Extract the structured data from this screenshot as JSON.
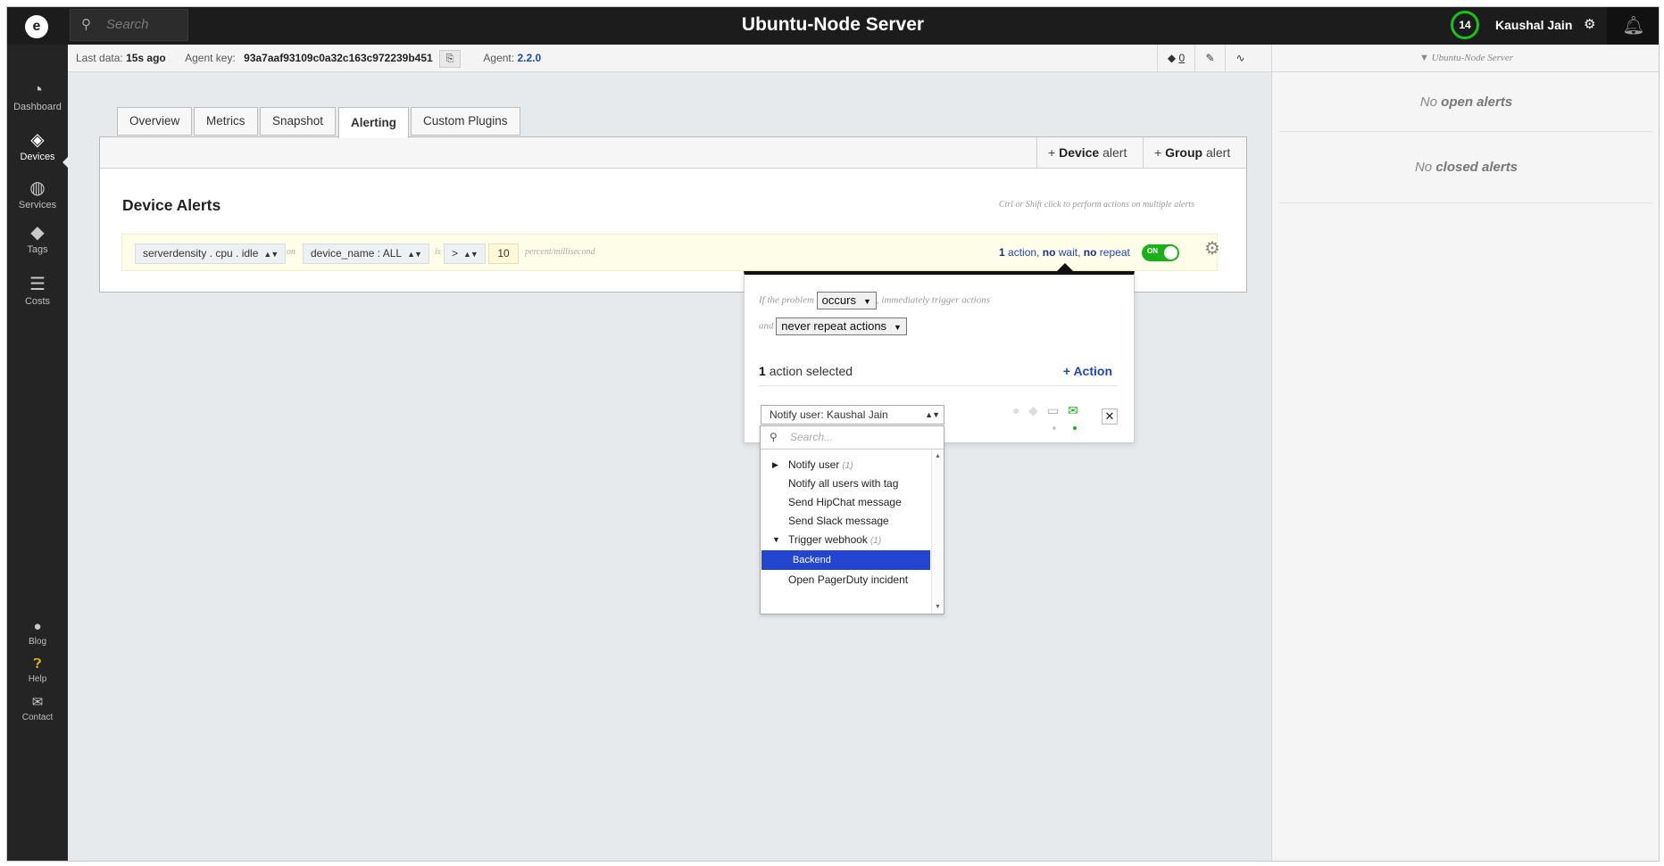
{
  "app": {
    "logo": "e",
    "search_placeholder": "Search",
    "title": "Ubuntu-Node Server",
    "notification_count": "14",
    "user_name": "Kaushal Jain"
  },
  "nav": {
    "dashboard": "Dashboard",
    "devices": "Devices",
    "services": "Services",
    "tags": "Tags",
    "costs": "Costs",
    "blog": "Blog",
    "help": "Help",
    "contact": "Contact"
  },
  "infobar": {
    "last_data_label": "Last data:",
    "last_data_value": "15s ago",
    "agent_key_label": "Agent key:",
    "agent_key_value": "93a7aaf93109c0a32c163c972239b451",
    "agent_label": "Agent:",
    "agent_version": "2.2.0",
    "tag_count": "0"
  },
  "right_panel": {
    "filter_label": "Ubuntu-Node Server",
    "open_alerts_prefix": "No",
    "open_alerts_suffix": "open alerts",
    "closed_alerts_prefix": "No",
    "closed_alerts_suffix": "closed alerts"
  },
  "tabs": [
    "Overview",
    "Metrics",
    "Snapshot",
    "Alerting",
    "Custom Plugins"
  ],
  "active_tab": "Alerting",
  "panel": {
    "device_alert_bold": "Device",
    "device_alert_rest": "alert",
    "group_alert_bold": "Group",
    "group_alert_rest": "alert",
    "title": "Device Alerts",
    "hint": "Ctrl or Shift click to perform actions on multiple alerts"
  },
  "alert": {
    "metric": "serverdensity . cpu . idle",
    "on_word": "on",
    "scope": "device_name : ALL",
    "is_word": "is",
    "operator": ">",
    "value": "10",
    "unit": "percent/millisecond",
    "summary_count": "1",
    "summary_action": "action,",
    "summary_no1": "no",
    "summary_wait": "wait,",
    "summary_no2": "no",
    "summary_repeat": "repeat",
    "toggle_state": "ON",
    "toggle_color": "#1bb01b"
  },
  "popover": {
    "line1_prefix": "If the problem",
    "trigger_option": "occurs",
    "line1_suffix": ", immediately trigger actions",
    "line2_prefix": "and",
    "repeat_option": "never repeat actions",
    "selected_count": "1",
    "selected_label": "action selected",
    "add_action": "Action",
    "notify_select": "Notify user: Kaushal Jain"
  },
  "dropdown": {
    "search_placeholder": "Search...",
    "items": [
      {
        "label": "Notify user",
        "count": "(1)"
      },
      {
        "label": "Notify all users with tag"
      },
      {
        "label": "Send HipChat message"
      },
      {
        "label": "Send Slack message"
      },
      {
        "label": "Trigger webhook",
        "count": "(1)"
      },
      {
        "label": "Backend"
      },
      {
        "label": "Open PagerDuty incident"
      }
    ]
  },
  "colors": {
    "accent": "#2245c0",
    "selected": "#2345d0",
    "badge_ring": "#1bc11b",
    "topbar": "#1c1c1c"
  }
}
